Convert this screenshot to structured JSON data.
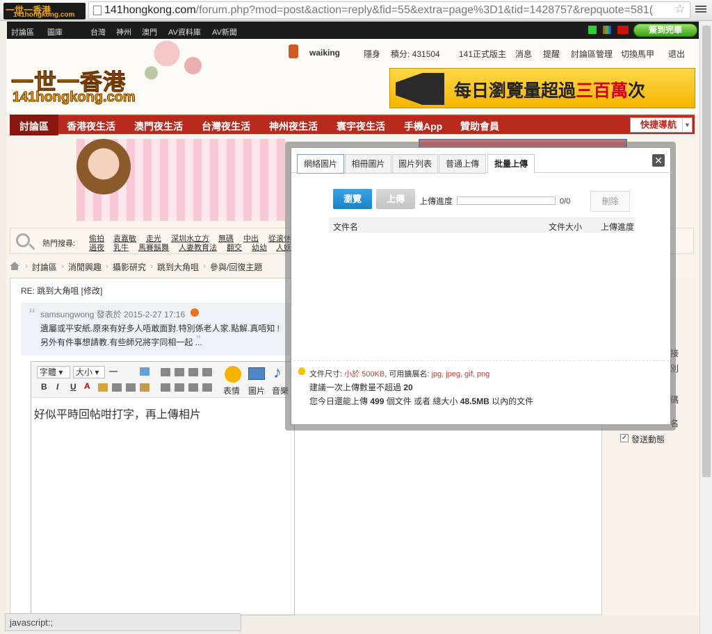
{
  "browser": {
    "favicon_line1": "一世一香港",
    "favicon_line2": "141hongkong.com",
    "url_host": "141hongkong.com",
    "url_path": "/forum.php?mod=post&action=reply&fid=55&extra=page%3D1&tid=1428757&repquote=581(",
    "status_text": "javascript:;"
  },
  "topbar": {
    "links": [
      "討論區",
      "圖庫",
      "台灣",
      "神州",
      "澳門",
      "AV資料庫",
      "AV新聞"
    ],
    "signin_label": "簽到完畢"
  },
  "site": {
    "logo_cn": "一世一香港",
    "logo_en": "141hongkong.com",
    "banner_prefix": "每日瀏覽量超過",
    "banner_highlight": "三百萬",
    "banner_suffix": "次"
  },
  "userbar": {
    "username": "waiking",
    "items": [
      "隱身",
      "積分: 431504",
      "141正式版主",
      "消息",
      "提醒",
      "討論區管理",
      "切換馬甲",
      "退出"
    ]
  },
  "navbar": {
    "items": [
      "討論區",
      "香港夜生活",
      "澳門夜生活",
      "台灣夜生活",
      "神州夜生活",
      "寰宇夜生活",
      "手機App",
      "贊助會員"
    ],
    "quicknav_label": "快捷導航"
  },
  "hotsearch": {
    "label": "熱門搜尋:",
    "row1": [
      "偷拍",
      "袁嘉敏",
      "走光",
      "深圳水立方",
      "無碼",
      "中出",
      "從滚休"
    ],
    "row2": [
      "過夜",
      "乳牛",
      "馬賽鬍舞",
      "人妻教育法",
      "翻交",
      "幼幼",
      "人妖"
    ]
  },
  "breadcrumb": [
    "討論區",
    "消閒興趣",
    "攝影研究",
    "跳到大角咀",
    "參與/回復主題"
  ],
  "post": {
    "title": "RE: 跳到大角咀 [修改]",
    "quote_meta": "samsungwong 發表於 2015-2-27 17:16",
    "quote_line1": "遺屬或平安紙.原來有好多人唔敢面對.特別係老人家.點解.真唔知 !",
    "quote_line2": "另外有件事想請教.有些師兄將字同相一起 ...",
    "editor_font": "字體",
    "editor_size": "大小",
    "editor_emoji_label": "表情",
    "editor_image_label": "圖片",
    "editor_music_label": "音樂",
    "editor_body": "好似平時回帖咁打字，再上傳相片"
  },
  "sidebar": {
    "options": [
      "接",
      "別",
      "代碼",
      "名",
      "發送動態"
    ],
    "last_checked": true
  },
  "dialog": {
    "tabs": [
      "網絡圖片",
      "相冊圖片",
      "圖片列表",
      "普通上傳",
      "批量上傳"
    ],
    "active_tab": "批量上傳",
    "browse_label": "瀏覽",
    "upload_label": "上傳",
    "progress_label": "上傳進度",
    "progress_value": 0,
    "progress_count": "0/0",
    "delete_label": "刪除",
    "col_filename": "文件名",
    "col_filesize": "文件大小",
    "col_progress": "上傳進度",
    "info_size_prefix": "文件尺寸:",
    "info_size_value": "小於 500KB",
    "info_ext_prefix": ", 可用擴展名:",
    "info_ext_value": "jpg, jpeg, gif, png",
    "info_count_prefix": "建議一次上傳數量不超過",
    "info_count_value": "20",
    "info_today_prefix": "您今日還能上傳",
    "info_today_count": "499",
    "info_today_mid": "個文件 或者 總大小",
    "info_today_size": "48.5MB",
    "info_today_suffix": "以內的文件"
  }
}
